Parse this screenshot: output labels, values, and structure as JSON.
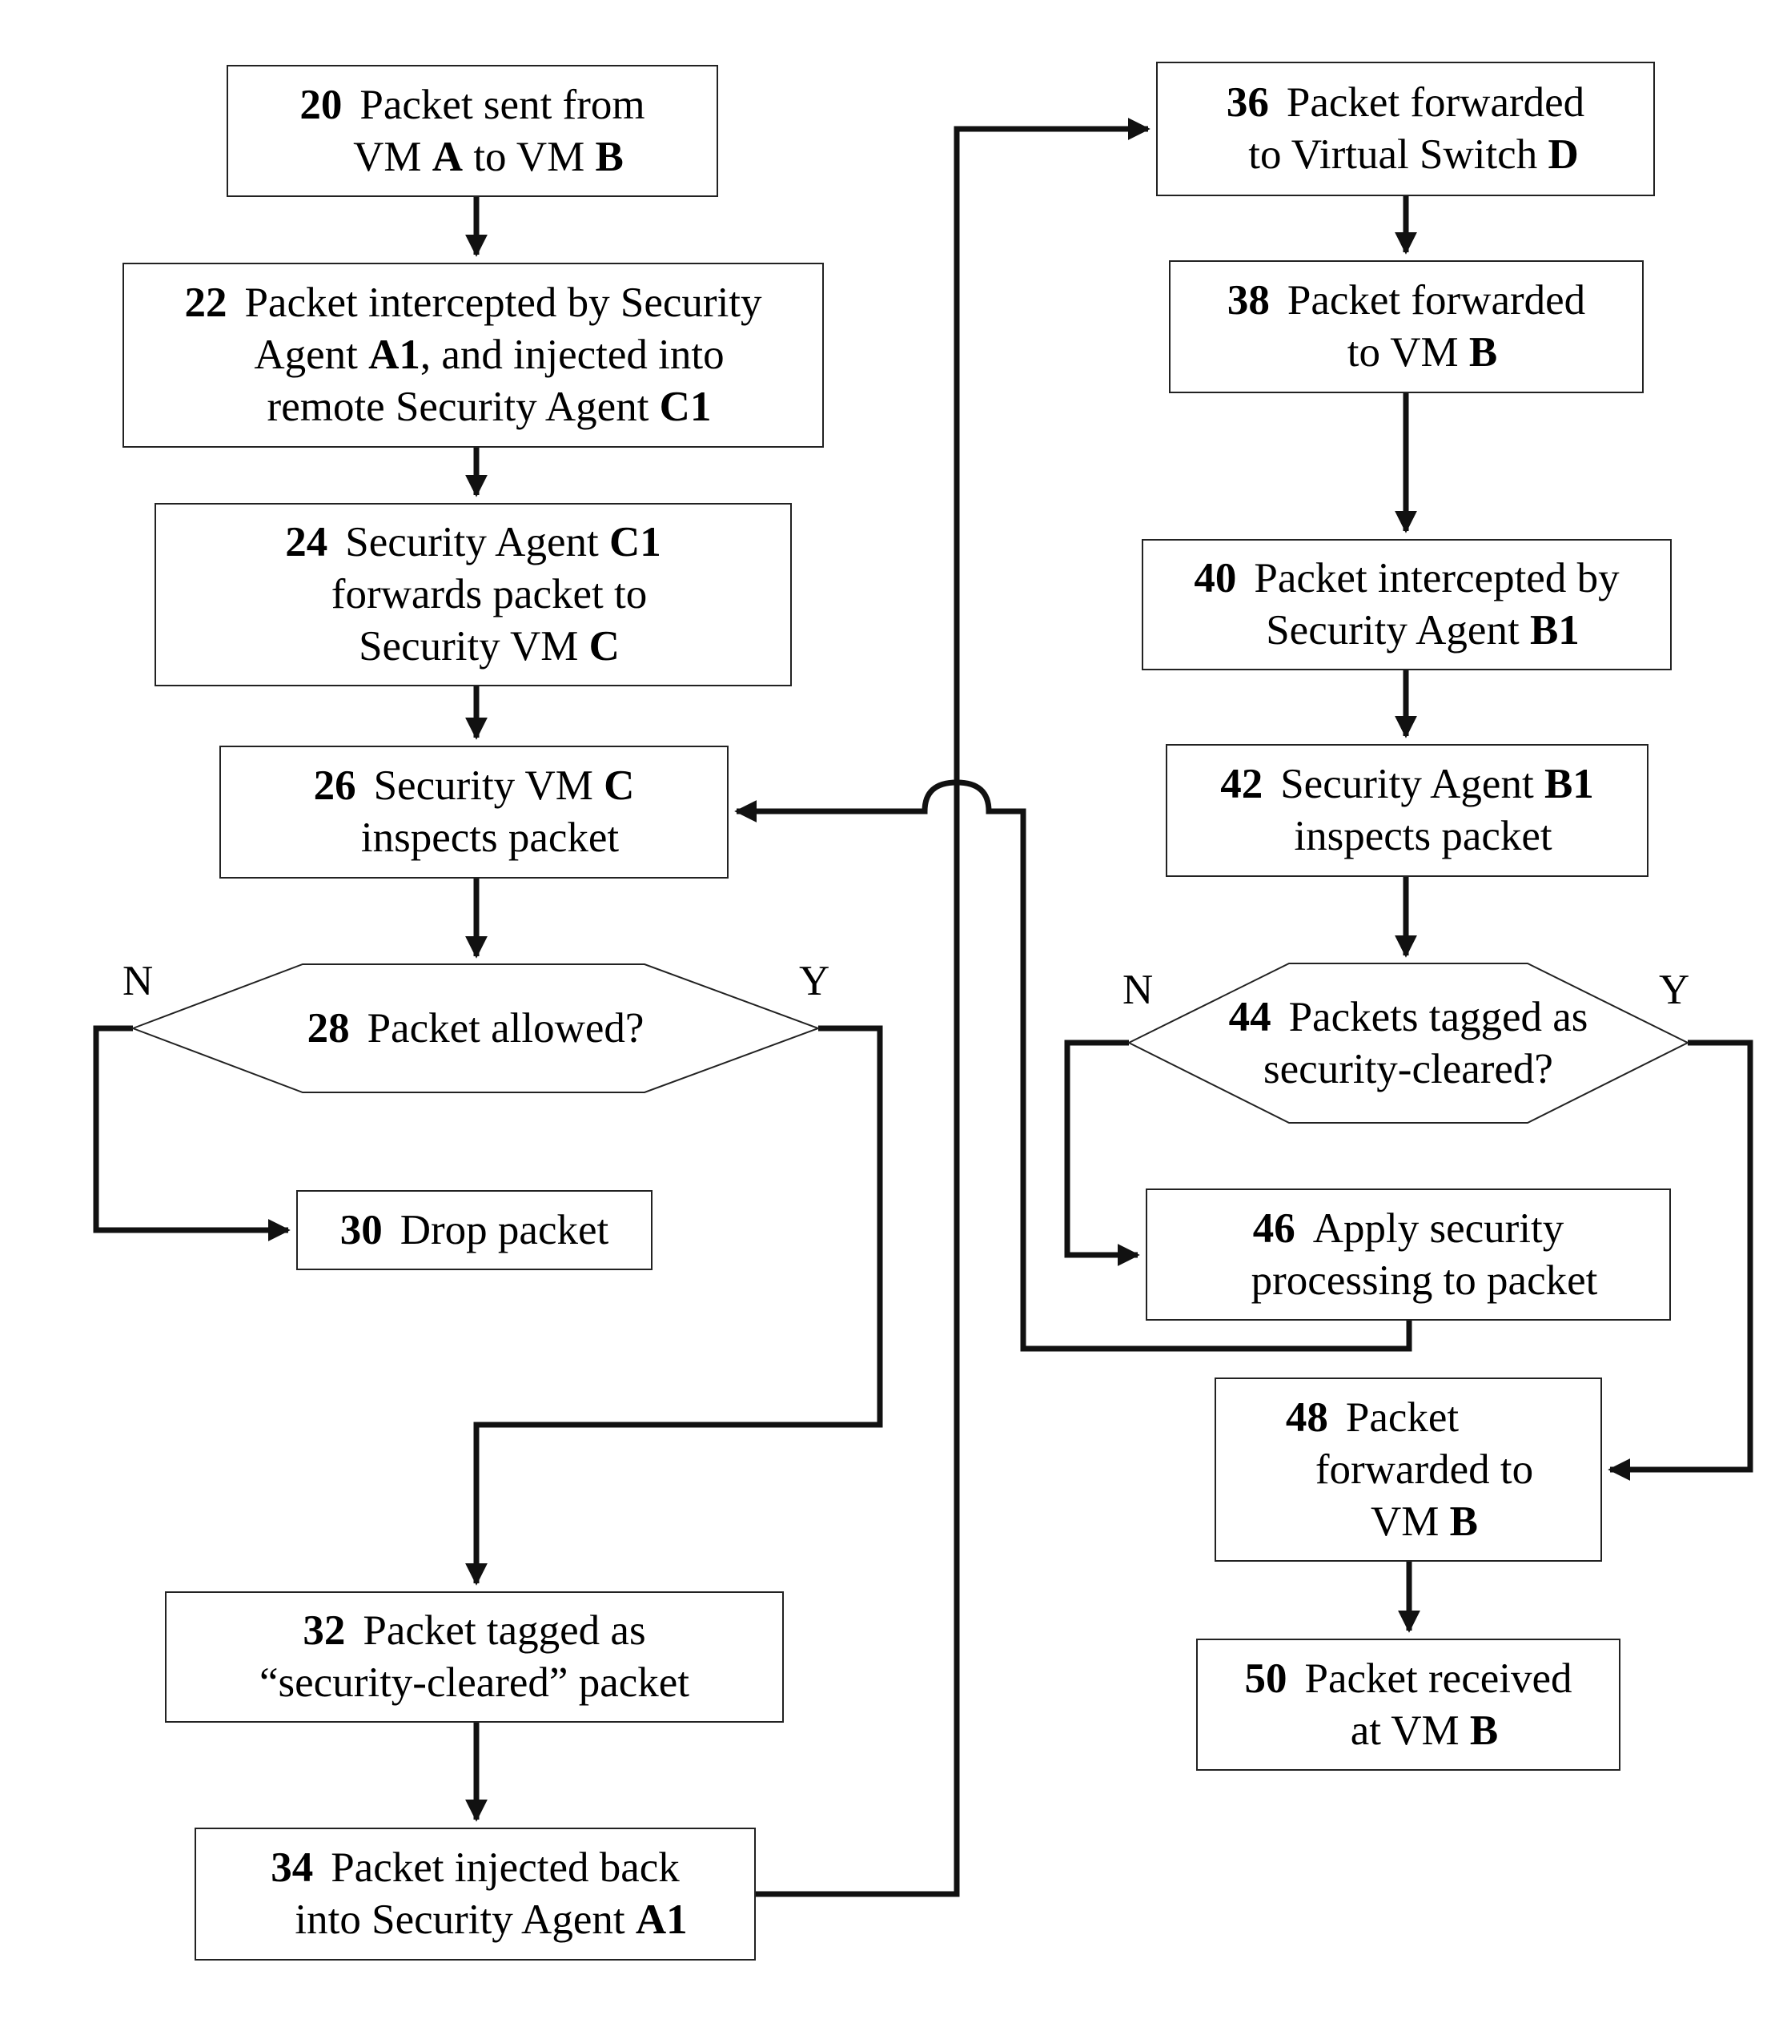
{
  "steps": {
    "s20": {
      "num": "20",
      "l1": "Packet sent from",
      "l2a": "VM ",
      "l2b": "A",
      "l2c": " to VM ",
      "l2d": "B"
    },
    "s22": {
      "num": "22",
      "l1": "Packet intercepted by Security",
      "l2a": "Agent ",
      "l2b": "A1",
      "l2c": ", and injected into",
      "l3a": "remote Security Agent ",
      "l3b": "C1"
    },
    "s24": {
      "num": "24",
      "l1a": "Security Agent ",
      "l1b": "C1",
      "l2": "forwards packet to",
      "l3a": "Security VM ",
      "l3b": "C"
    },
    "s26": {
      "num": "26",
      "l1a": "Security VM ",
      "l1b": "C",
      "l2": "inspects packet"
    },
    "s28": {
      "num": "28",
      "l1": "Packet allowed?",
      "no": "N",
      "yes": "Y"
    },
    "s30": {
      "num": "30",
      "l1": "Drop packet"
    },
    "s32": {
      "num": "32",
      "l1": "Packet tagged as",
      "l2": "“security-cleared” packet"
    },
    "s34": {
      "num": "34",
      "l1": "Packet injected back",
      "l2a": "into Security Agent ",
      "l2b": "A1"
    },
    "s36": {
      "num": "36",
      "l1": "Packet forwarded",
      "l2a": "to Virtual Switch ",
      "l2b": "D"
    },
    "s38": {
      "num": "38",
      "l1": "Packet forwarded",
      "l2a": "to VM ",
      "l2b": "B"
    },
    "s40": {
      "num": "40",
      "l1": "Packet intercepted by",
      "l2a": "Security Agent ",
      "l2b": "B1"
    },
    "s42": {
      "num": "42",
      "l1a": "Security Agent ",
      "l1b": "B1",
      "l2": "inspects packet"
    },
    "s44": {
      "num": "44",
      "l1": "Packets tagged as",
      "l2": "security-cleared?",
      "no": "N",
      "yes": "Y"
    },
    "s46": {
      "num": "46",
      "l1": "Apply security",
      "l2": "processing to packet"
    },
    "s48": {
      "num": "48",
      "l1": "Packet",
      "l2": "forwarded to",
      "l3a": "VM ",
      "l3b": "B"
    },
    "s50": {
      "num": "50",
      "l1": "Packet received",
      "l2a": "at VM ",
      "l2b": "B"
    }
  }
}
